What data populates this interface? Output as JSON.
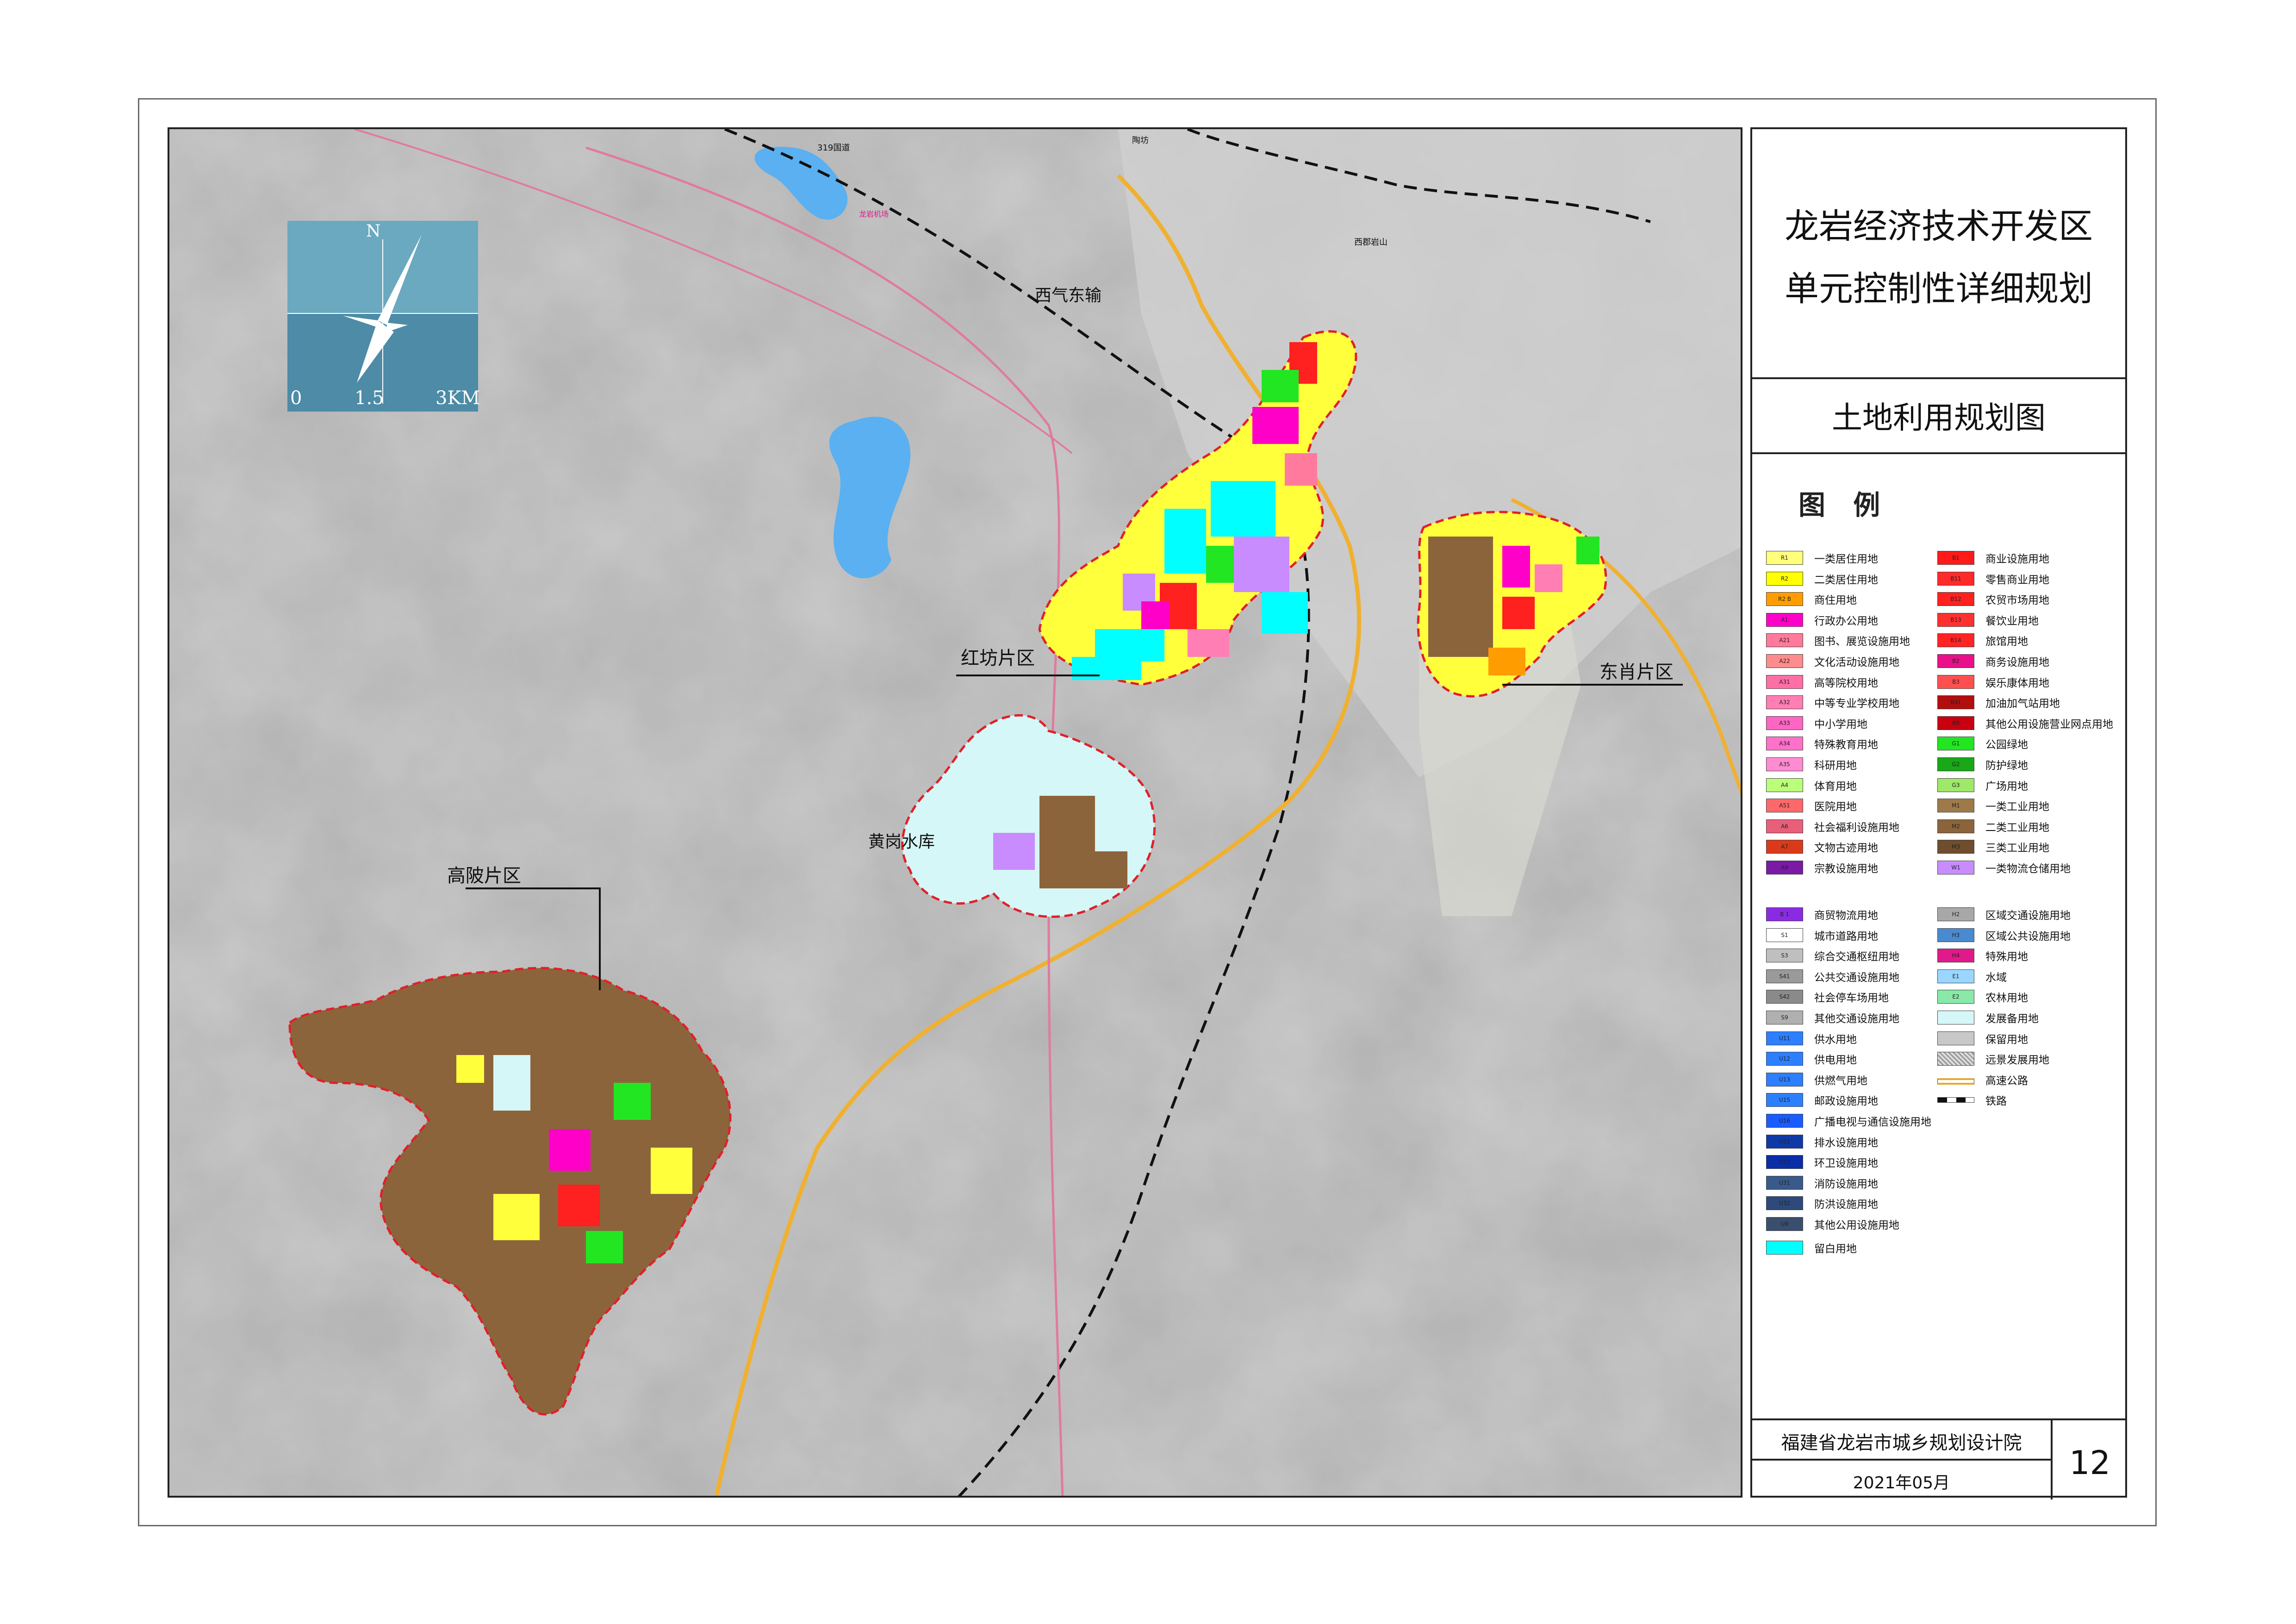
{
  "title": {
    "line1": "龙岩经济技术开发区",
    "line2": "单元控制性详细规划",
    "subtitle": "土地利用规划图"
  },
  "legend": {
    "heading": "图 例",
    "items": [
      {
        "code": "R1",
        "label": "一类居住用地",
        "color": "#ffff7a"
      },
      {
        "code": "R2",
        "label": "二类居住用地",
        "color": "#ffff00"
      },
      {
        "code": "R2 B",
        "label": "商住用地",
        "color": "#ff9d00"
      },
      {
        "code": "A1",
        "label": "行政办公用地",
        "color": "#ff00c8"
      },
      {
        "code": "A21",
        "label": "图书、展览设施用地",
        "color": "#ff7a9c"
      },
      {
        "code": "A22",
        "label": "文化活动设施用地",
        "color": "#ff8c8c"
      },
      {
        "code": "A31",
        "label": "高等院校用地",
        "color": "#ff6fa5"
      },
      {
        "code": "A32",
        "label": "中等专业学校用地",
        "color": "#ff7fb5"
      },
      {
        "code": "A33",
        "label": "中小学用地",
        "color": "#ff66c4"
      },
      {
        "code": "A34",
        "label": "特殊教育用地",
        "color": "#ff70c8"
      },
      {
        "code": "A35",
        "label": "科研用地",
        "color": "#ff8cd2"
      },
      {
        "code": "A4",
        "label": "体育用地",
        "color": "#baff7a"
      },
      {
        "code": "A51",
        "label": "医院用地",
        "color": "#ff6868"
      },
      {
        "code": "A6",
        "label": "社会福利设施用地",
        "color": "#e85f7a"
      },
      {
        "code": "A7",
        "label": "文物古迹用地",
        "color": "#d93a1a"
      },
      {
        "code": "A9",
        "label": "宗教设施用地",
        "color": "#7a1aa5"
      },
      {
        "code": "B1",
        "label": "商业设施用地",
        "color": "#ff1a1a"
      },
      {
        "code": "B11",
        "label": "零售商业用地",
        "color": "#ff2a2a"
      },
      {
        "code": "B12",
        "label": "农贸市场用地",
        "color": "#ff2020"
      },
      {
        "code": "B13",
        "label": "餐饮业用地",
        "color": "#ff3030"
      },
      {
        "code": "B14",
        "label": "旅馆用地",
        "color": "#ff2424"
      },
      {
        "code": "B2",
        "label": "商务设施用地",
        "color": "#e8118a"
      },
      {
        "code": "B3",
        "label": "娱乐康体用地",
        "color": "#ff5050"
      },
      {
        "code": "B41",
        "label": "加油加气站用地",
        "color": "#b30e0e"
      },
      {
        "code": "B9",
        "label": "其他公用设施营业网点用地",
        "color": "#c80010"
      },
      {
        "code": "G1",
        "label": "公园绿地",
        "color": "#22e622"
      },
      {
        "code": "G2",
        "label": "防护绿地",
        "color": "#18a818"
      },
      {
        "code": "G3",
        "label": "广场用地",
        "color": "#9ee86a"
      },
      {
        "code": "M1",
        "label": "一类工业用地",
        "color": "#9e7a4a"
      },
      {
        "code": "M2",
        "label": "二类工业用地",
        "color": "#8c643c"
      },
      {
        "code": "M3",
        "label": "三类工业用地",
        "color": "#6e4e2e"
      },
      {
        "code": "W1",
        "label": "一类物流仓储用地",
        "color": "#c88cff"
      },
      {
        "code": "B 1",
        "label": "商贸物流用地",
        "color": "#8a2be2"
      },
      {
        "code": "S1",
        "label": "城市道路用地",
        "color": "#ffffff"
      },
      {
        "code": "S3",
        "label": "综合交通枢纽用地",
        "color": "#bfbfbf"
      },
      {
        "code": "S41",
        "label": "公共交通设施用地",
        "color": "#9a9a9a"
      },
      {
        "code": "S42",
        "label": "社会停车场用地",
        "color": "#8a8a8a"
      },
      {
        "code": "S9",
        "label": "其他交通设施用地",
        "color": "#b0b0b0"
      },
      {
        "code": "U11",
        "label": "供水用地",
        "color": "#2c7fff"
      },
      {
        "code": "U12",
        "label": "供电用地",
        "color": "#2c7fff"
      },
      {
        "code": "U13",
        "label": "供燃气用地",
        "color": "#2c7fff"
      },
      {
        "code": "U15",
        "label": "邮政设施用地",
        "color": "#2c7fff"
      },
      {
        "code": "U16",
        "label": "广播电视与通信设施用地",
        "color": "#1a5cff"
      },
      {
        "code": "U21",
        "label": "排水设施用地",
        "color": "#0e3aa8"
      },
      {
        "code": "U22",
        "label": "环卫设施用地",
        "color": "#0a2ea8"
      },
      {
        "code": "U31",
        "label": "消防设施用地",
        "color": "#3a5a8c"
      },
      {
        "code": "U32",
        "label": "防洪设施用地",
        "color": "#2e4a7a"
      },
      {
        "code": "U9",
        "label": "其他公用设施用地",
        "color": "#3a4e6e"
      },
      {
        "code": "",
        "label": "留白用地",
        "color": "#00ffff"
      },
      {
        "code": "H2",
        "label": "区域交通设施用地",
        "color": "#a8a8a8"
      },
      {
        "code": "H3",
        "label": "区域公共设施用地",
        "color": "#4a8ad0"
      },
      {
        "code": "H4",
        "label": "特殊用地",
        "color": "#e01a8a"
      },
      {
        "code": "E1",
        "label": "水域",
        "color": "#9ad6ff"
      },
      {
        "code": "E2",
        "label": "农林用地",
        "color": "#8ae8a8"
      },
      {
        "code": "",
        "label": "发展备用地",
        "color": "#d6f7f7"
      },
      {
        "code": "",
        "label": "保留用地",
        "color": "#c8c8c8"
      },
      {
        "code": "",
        "label": "远景发展用地",
        "color": "#bdbdbd"
      },
      {
        "code": "",
        "label": "高速公路",
        "color": "#e8a830"
      },
      {
        "code": "",
        "label": "铁路",
        "color": "#111111"
      }
    ]
  },
  "north_arrow": {
    "n_label": "N",
    "scale": {
      "zero": "0",
      "mid": "1.5",
      "max": "3KM"
    }
  },
  "map_labels": {
    "xiqi": "西气东输",
    "hongfang": "红坊片区",
    "dongxiao": "东肖片区",
    "huanggang": "黄岗水库",
    "gaobei": "高陂片区",
    "road319": "319国道",
    "airport": "龙岩机场",
    "taofang": "陶坊",
    "xibeishan": "西郡岩山"
  },
  "footer": {
    "org": "福建省龙岩市城乡规划设计院",
    "date": "2021年05月",
    "page": "12"
  }
}
